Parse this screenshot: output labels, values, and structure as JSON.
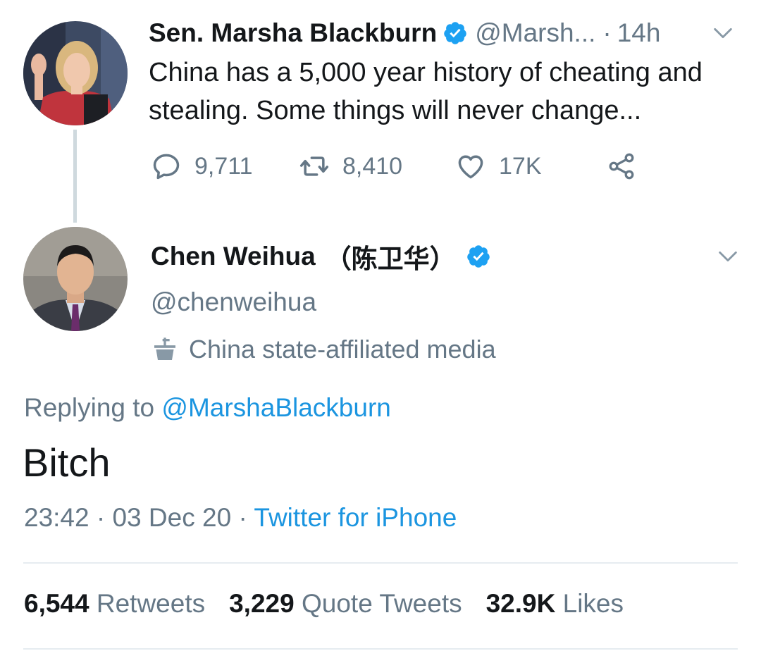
{
  "tweet1": {
    "name": "Sen. Marsha Blackburn",
    "handle": "@Marsh...",
    "separator": "·",
    "time": "14h",
    "text_line1": "China has a 5,000 year history of cheating and",
    "text_line2": "stealing. Some things will never change...",
    "reply_count": "9,711",
    "retweet_count": "8,410",
    "like_count": "17K"
  },
  "tweet2": {
    "name": "Chen Weihua",
    "name_cjk": "（陈卫华）",
    "handle": "@chenweihua",
    "label": "China state-affiliated media",
    "replying_prefix": "Replying to",
    "replying_mention": "@MarshaBlackburn",
    "text": "Bitch",
    "time": "23:42",
    "date": "03 Dec 20",
    "separator": "·",
    "client": "Twitter for iPhone",
    "retweets_count": "6,544",
    "retweets_label": "Retweets",
    "quotes_count": "3,229",
    "quotes_label": "Quote Tweets",
    "likes_count": "32.9K",
    "likes_label": "Likes"
  },
  "colors": {
    "verified": "#1da1f2",
    "link": "#1b95e0",
    "secondary_text": "#657786",
    "primary_text": "#14171a",
    "divider": "#e6ecf0"
  },
  "icons": [
    "verified-badge-icon",
    "chevron-down-icon",
    "reply-icon",
    "retweet-icon",
    "like-icon",
    "share-icon",
    "state-media-icon"
  ]
}
